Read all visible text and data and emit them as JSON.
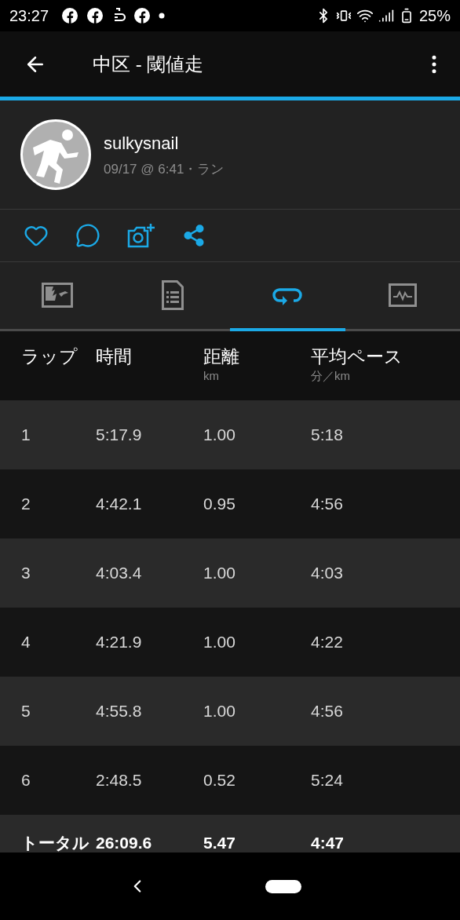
{
  "status_bar": {
    "time": "23:27",
    "battery": "25%"
  },
  "app_bar": {
    "title": "中区 - 閾値走"
  },
  "activity": {
    "user": "sulkysnail",
    "meta": "09/17 @ 6:41・ラン"
  },
  "tabs": [
    {
      "kind": "map",
      "selected": false
    },
    {
      "kind": "details",
      "selected": false
    },
    {
      "kind": "laps",
      "selected": true
    },
    {
      "kind": "chart",
      "selected": false
    }
  ],
  "table": {
    "columns": [
      {
        "label": "ラップ"
      },
      {
        "label": "時間"
      },
      {
        "label": "距離",
        "unit": "km"
      },
      {
        "label": "平均ペース",
        "unit": "分／km"
      }
    ],
    "rows": [
      [
        "1",
        "5:17.9",
        "1.00",
        "5:18"
      ],
      [
        "2",
        "4:42.1",
        "0.95",
        "4:56"
      ],
      [
        "3",
        "4:03.4",
        "1.00",
        "4:03"
      ],
      [
        "4",
        "4:21.9",
        "1.00",
        "4:22"
      ],
      [
        "5",
        "4:55.8",
        "1.00",
        "4:56"
      ],
      [
        "6",
        "2:48.5",
        "0.52",
        "5:24"
      ]
    ],
    "total": [
      "トータル",
      "26:09.6",
      "5.47",
      "4:47"
    ]
  }
}
